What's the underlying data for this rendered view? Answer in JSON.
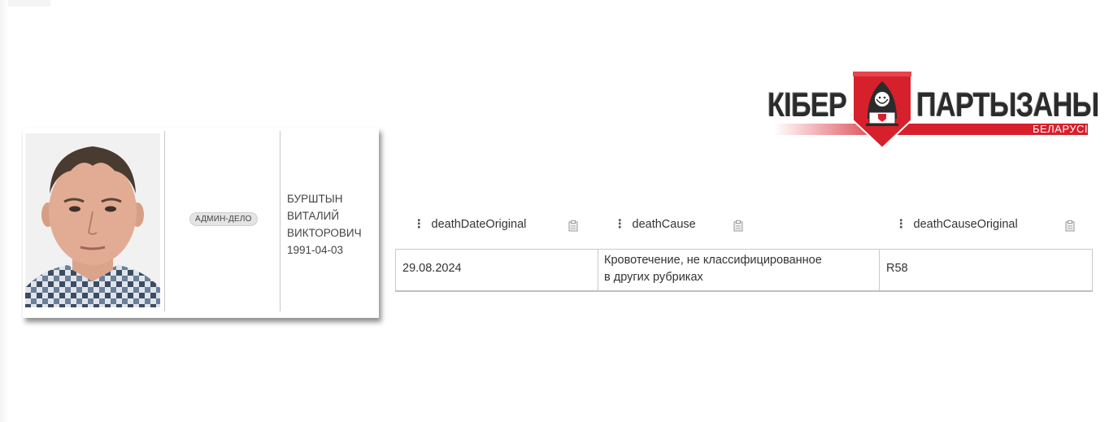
{
  "logo": {
    "word_left": "КІБЕР",
    "word_right": "ПАРТЫЗАНЫ",
    "country": "БЕЛАРУСІ",
    "colors": {
      "red": "#d6202c",
      "dark": "#2b2b2b"
    }
  },
  "profile": {
    "badge": "АДМИН-ДЕЛО",
    "surname": "БУРШТЫН",
    "first_name": "ВИТАЛИЙ",
    "patronymic": "ВИКТОРОВИЧ",
    "birth_date": "1991-04-03"
  },
  "table": {
    "columns": [
      {
        "label": "deathDateOriginal",
        "grip_icon": "drag-handle-icon",
        "clip_icon": "clipboard-icon"
      },
      {
        "label": "deathCause",
        "grip_icon": "drag-handle-icon",
        "clip_icon": "clipboard-icon"
      },
      {
        "label": "deathCauseOriginal",
        "grip_icon": "drag-handle-icon",
        "clip_icon": "clipboard-icon"
      }
    ],
    "row": {
      "deathDateOriginal": "29.08.2024",
      "deathCause_line1": "Кровотечение, не классифицированное",
      "deathCause_line2": "в других рубриках",
      "deathCauseOriginal": "R58"
    }
  }
}
